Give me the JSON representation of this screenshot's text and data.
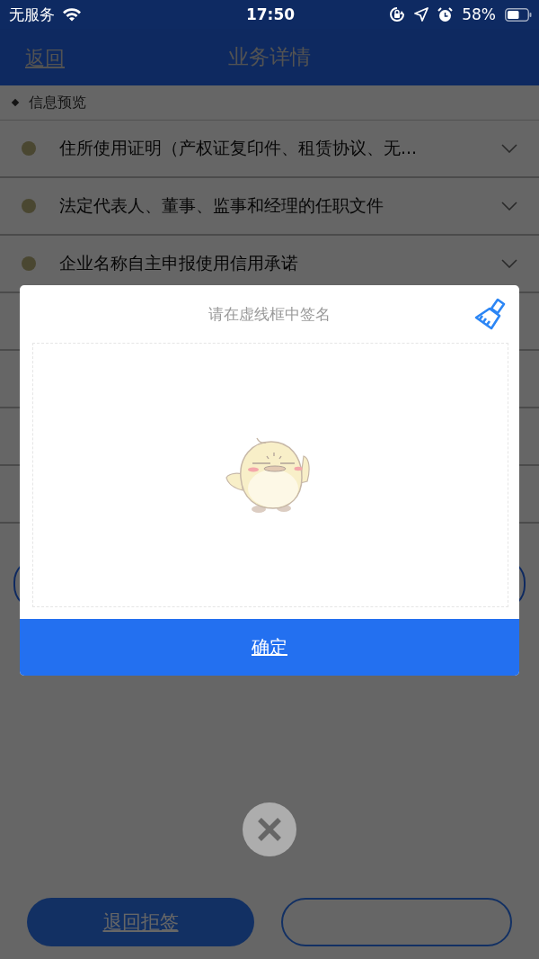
{
  "status_bar": {
    "carrier": "无服务",
    "time": "17:50",
    "battery": "58%"
  },
  "header": {
    "back": "返回",
    "title": "业务详情"
  },
  "section": {
    "title": "信息预览"
  },
  "documents": [
    {
      "title": "住所使用证明（产权证复印件、租赁协议、无..."
    },
    {
      "title": "法定代表人、董事、监事和经理的任职文件"
    },
    {
      "title": "企业名称自主申报使用信用承诺"
    }
  ],
  "footer_buttons": [
    {
      "label": "退回拒签",
      "kind": "filled"
    },
    {
      "kind": "outline"
    }
  ],
  "signature_dialog": {
    "title": "请在虚线框中签名",
    "confirm": "确定"
  }
}
